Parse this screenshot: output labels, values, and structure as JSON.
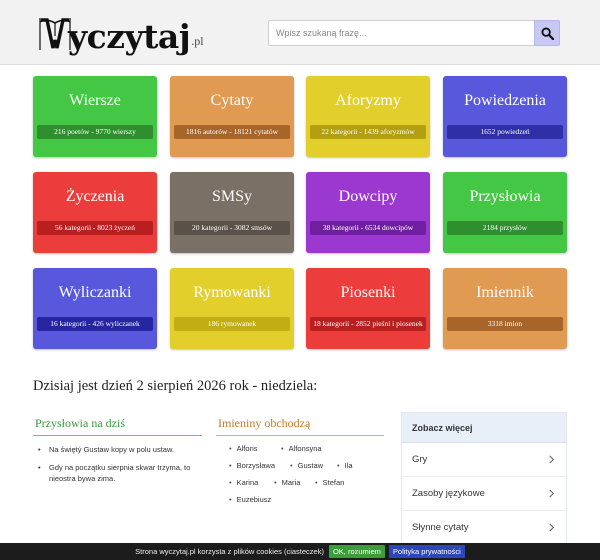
{
  "header": {
    "logo_text": "yczytaj",
    "logo_tld": ".pl",
    "search_placeholder": "Wpisz szukaną frazę..."
  },
  "tiles": [
    {
      "title": "Wiersze",
      "stats": "216 poetów - 9770 wierszy",
      "color": "#44c744",
      "stats_color": "#2f8f2f"
    },
    {
      "title": "Cytaty",
      "stats": "1816 autorów - 18121 cytatów",
      "color": "#e09a52",
      "stats_color": "#a8652a"
    },
    {
      "title": "Aforyzmy",
      "stats": "22 kategorii - 1439 aforyzmów",
      "color": "#e3cf2b",
      "stats_color": "#b39f10"
    },
    {
      "title": "Powiedzenia",
      "stats": "1652 powiedzeń",
      "color": "#5858dc",
      "stats_color": "#2f2fa8"
    },
    {
      "title": "Życzenia",
      "stats": "56 kategorii - 8023 życzeń",
      "color": "#ec3d3d",
      "stats_color": "#b81f1f"
    },
    {
      "title": "SMSy",
      "stats": "20 kategorii - 3082 smsów",
      "color": "#7a7065",
      "stats_color": "#5a5248"
    },
    {
      "title": "Dowcipy",
      "stats": "38 kategorii - 6534 dowcipów",
      "color": "#9a38cf",
      "stats_color": "#6f1fa0"
    },
    {
      "title": "Przysłowia",
      "stats": "2184 przysłów",
      "color": "#44c744",
      "stats_color": "#2f8f2f"
    },
    {
      "title": "Wyliczanki",
      "stats": "16 kategorii - 426 wyliczanek",
      "color": "#5858dc",
      "stats_color": "#2626a0"
    },
    {
      "title": "Rymowanki",
      "stats": "186 rymowanek",
      "color": "#e3cf2b",
      "stats_color": "#c2ae14"
    },
    {
      "title": "Piosenki",
      "stats": "18 kategorii - 2852 pieśni i piosenek",
      "color": "#ec3d3d",
      "stats_color": "#b81f1f"
    },
    {
      "title": "Imiennik",
      "stats": "3318 imion",
      "color": "#e09a52",
      "stats_color": "#a8652a"
    }
  ],
  "date_line": "Dzisiaj jest dzień 2 sierpień 2026 rok - niedziela:",
  "proverbs": {
    "title": "Przysłowia na dziś",
    "items": [
      "Na świętý Gustaw kopy w polu ustaw.",
      "Gdy na początku sierpnia skwar trzyma, to nieostra bywa zima."
    ]
  },
  "namedays": {
    "title": "Imieniny obchodzą",
    "names": [
      "Alfons",
      "Alfonsyna",
      "Borzysława",
      "Gustaw",
      "Ila",
      "Karina",
      "Maria",
      "Stefan",
      "Euzebiusz"
    ]
  },
  "more": {
    "title": "Zobacz więcej",
    "items": [
      "Gry",
      "Zasoby językowe",
      "Słynne cytaty"
    ]
  },
  "cookie": {
    "text": "Strona wyczytaj.pl korzysta z plików cookies (ciasteczek)",
    "ok_label": "OK, rozumiem",
    "policy_label": "Polityka prywatności"
  }
}
